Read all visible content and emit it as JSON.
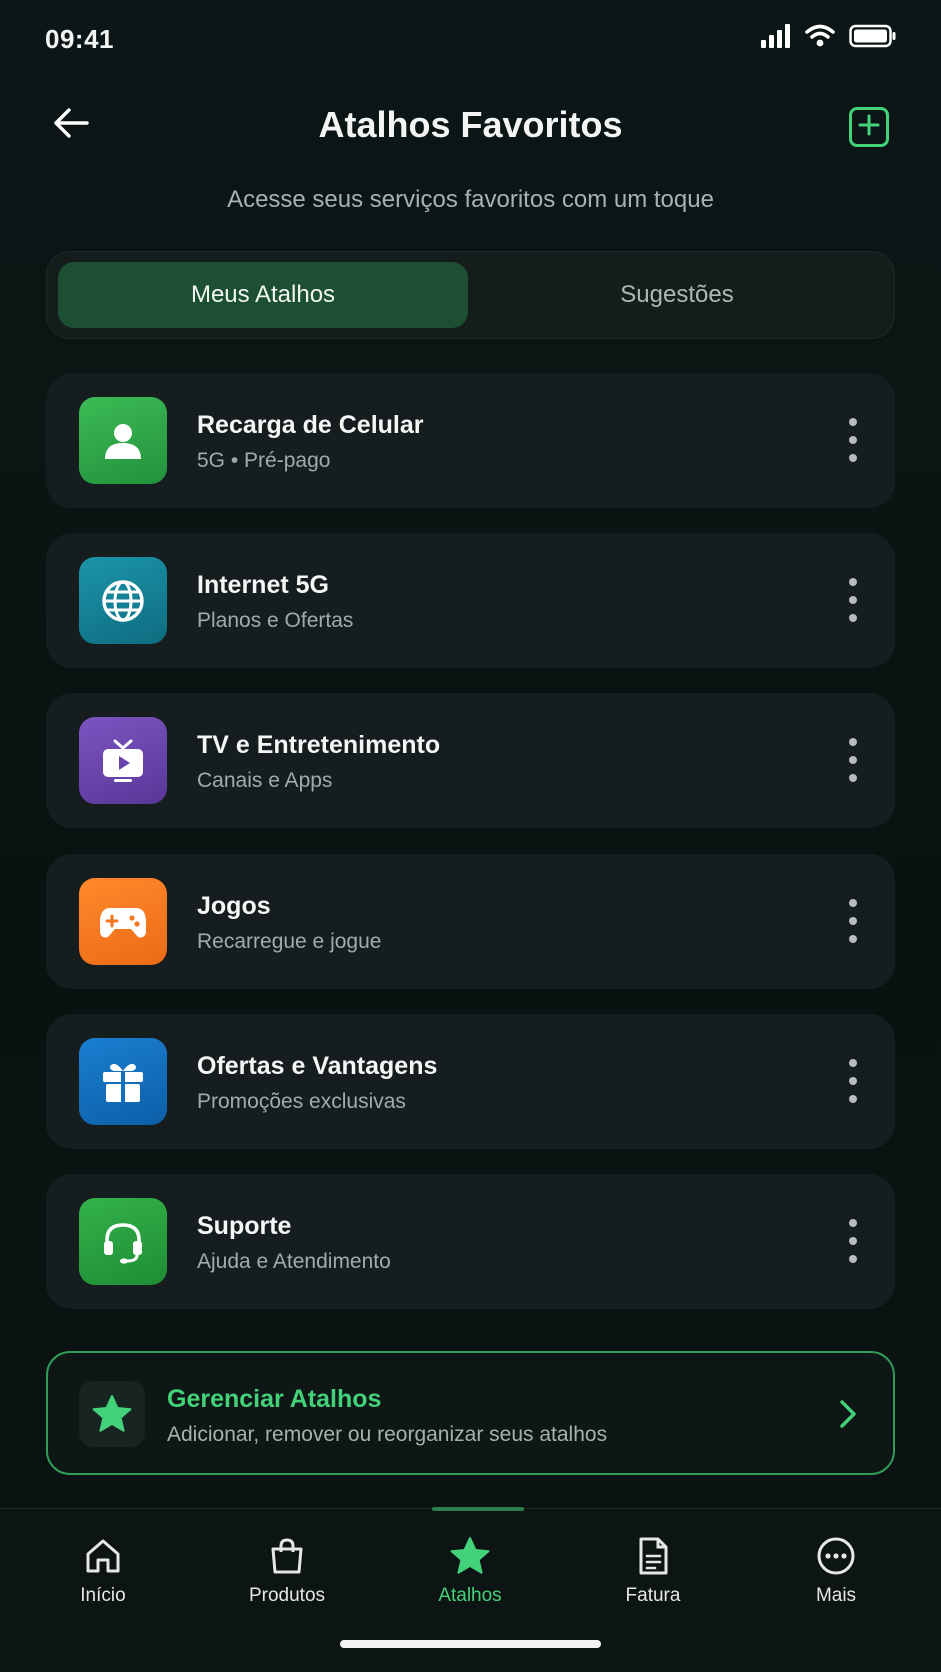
{
  "status_bar": {
    "time": "09:41",
    "icons": [
      "signal-icon",
      "wifi-icon",
      "battery-icon"
    ]
  },
  "header": {
    "title": "Atalhos Favoritos",
    "subtitle": "Acesse seus serviços favoritos com um toque",
    "back_icon": "arrow-left-icon",
    "add_icon": "plus-square-icon"
  },
  "tabs": [
    {
      "label": "Meus Atalhos",
      "selected": true
    },
    {
      "label": "Sugestões",
      "selected": false
    }
  ],
  "shortcuts": [
    {
      "title": "Recarga de Celular",
      "subtitle": "5G • Pré-pago",
      "icon": "user-icon",
      "color": "#2fa84a"
    },
    {
      "title": "Internet 5G",
      "subtitle": "Planos e Ofertas",
      "icon": "globe-icon",
      "color": "#137f94"
    },
    {
      "title": "TV e Entretenimento",
      "subtitle": "Canais e Apps",
      "icon": "tv-icon",
      "color": "#6a43ad"
    },
    {
      "title": "Jogos",
      "subtitle": "Recarregue e jogue",
      "icon": "gamepad-icon",
      "color": "#f37721"
    },
    {
      "title": "Ofertas e Vantagens",
      "subtitle": "Promoções exclusivas",
      "icon": "gift-icon",
      "color": "#0f6fc0"
    },
    {
      "title": "Suporte",
      "subtitle": "Ajuda e Atendimento",
      "icon": "headset-icon",
      "color": "#27a239"
    }
  ],
  "manage": {
    "title": "Gerenciar Atalhos",
    "subtitle": "Adicionar, remover ou reorganizar seus atalhos",
    "icon": "star-icon"
  },
  "bottom_nav": [
    {
      "label": "Início",
      "icon": "home-icon",
      "active": false
    },
    {
      "label": "Produtos",
      "icon": "shopping-bag-icon",
      "active": false
    },
    {
      "label": "Atalhos",
      "icon": "star-icon",
      "active": true
    },
    {
      "label": "Fatura",
      "icon": "invoice-icon",
      "active": false
    },
    {
      "label": "Mais",
      "icon": "more-icon",
      "active": false
    }
  ],
  "colors": {
    "accent": "#43d27a",
    "background": "#0b1212",
    "card": "#151d1e"
  }
}
